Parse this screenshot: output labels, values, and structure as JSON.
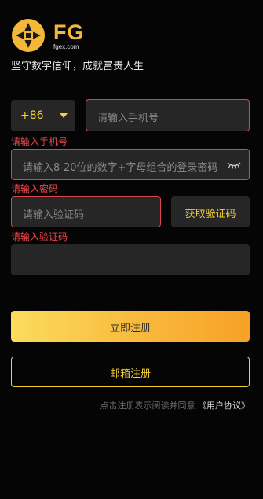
{
  "brand": {
    "logo_text": "FG",
    "logo_sub": "fgex.com",
    "slogan": "坚守数字信仰，成就富贵人生"
  },
  "form": {
    "country_code": "+86",
    "phone_placeholder": "请输入手机号",
    "phone_error": "请输入手机号",
    "password_placeholder": "请输入8-20位的数字+字母组合的登录密码",
    "password_error": "请输入密码",
    "code_placeholder": "请输入验证码",
    "get_code_label": "获取验证码",
    "code_error": "请输入验证码"
  },
  "actions": {
    "register_label": "立即注册",
    "email_register_label": "邮箱注册"
  },
  "agreement": {
    "text": "点击注册表示阅读并同意",
    "link": "《用户协议》"
  },
  "colors": {
    "accent": "#f5d233",
    "error": "#e8474c",
    "gradient_start": "#fbdc5c",
    "gradient_end": "#f7a126"
  }
}
